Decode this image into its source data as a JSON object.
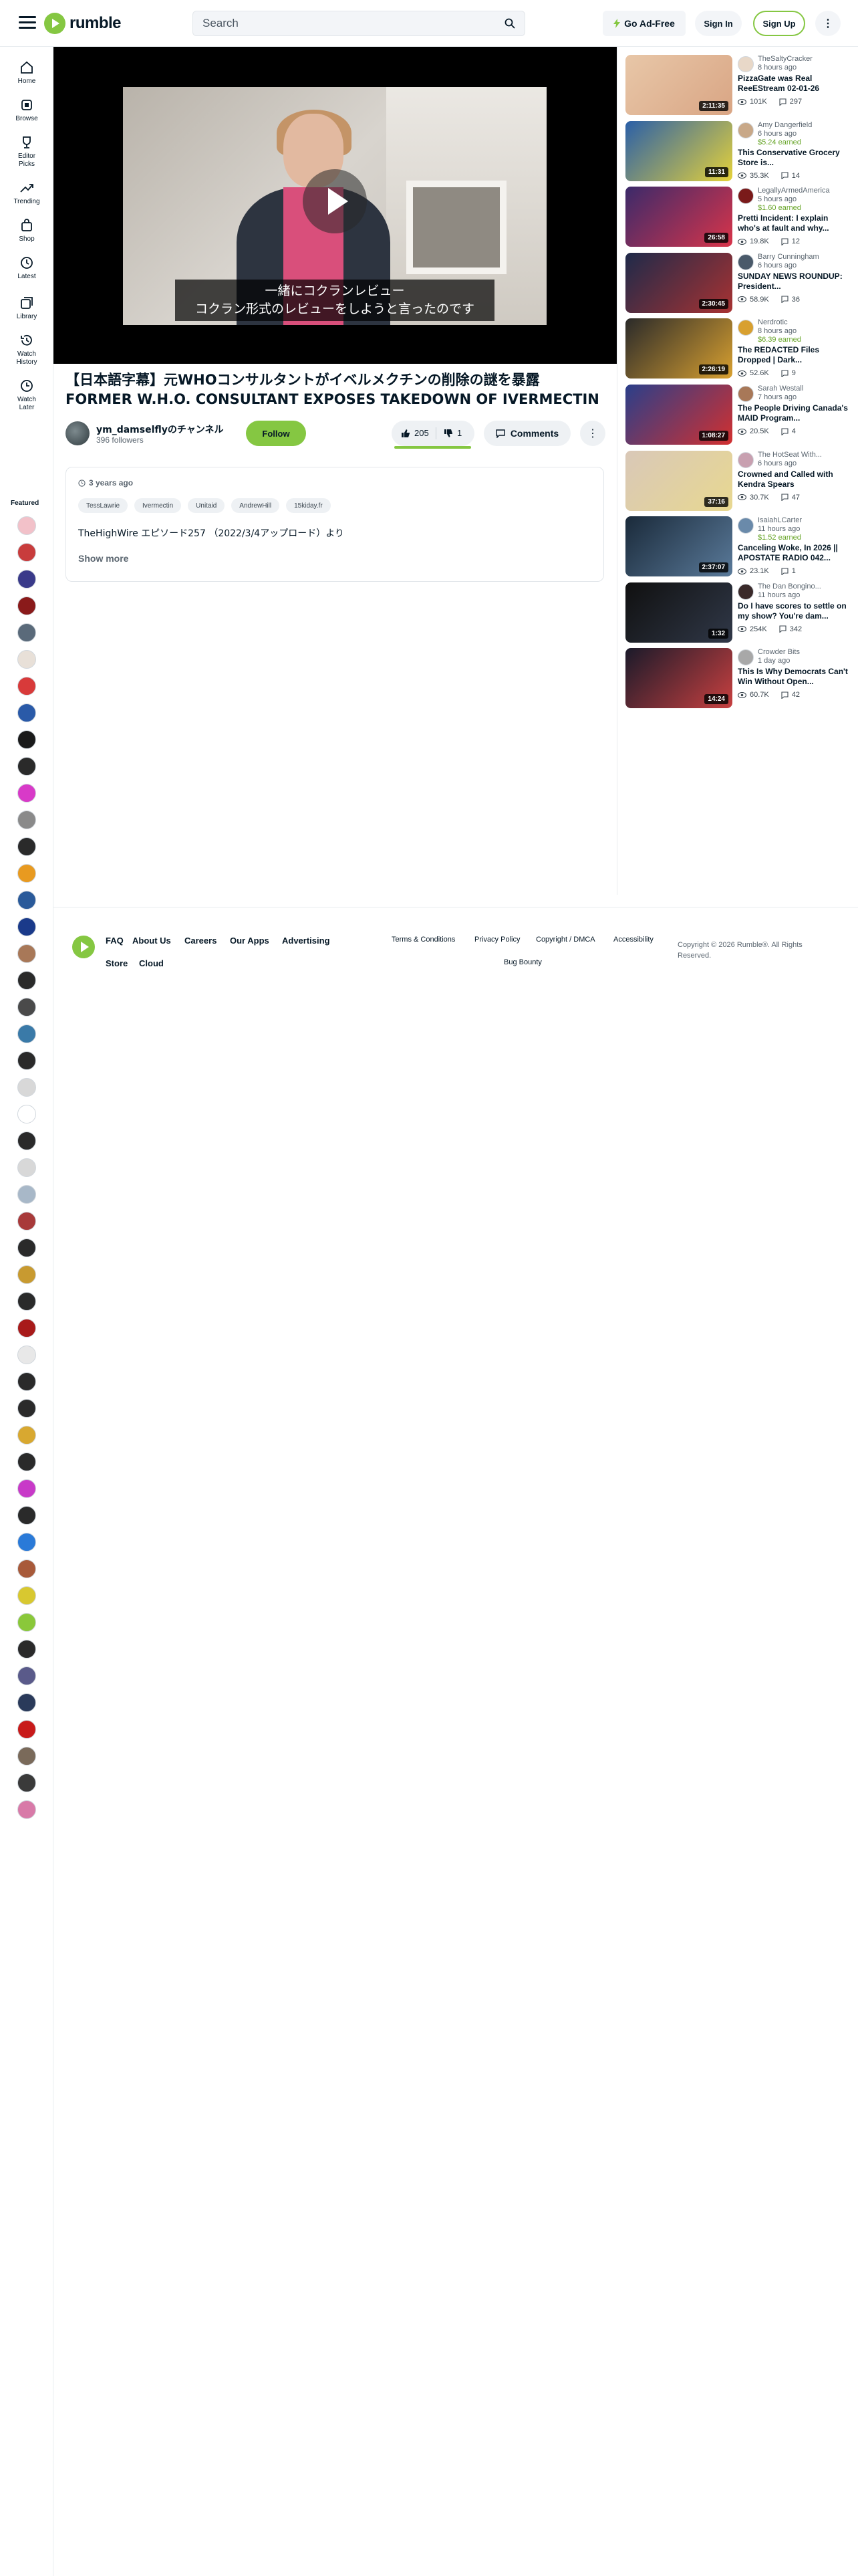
{
  "header": {
    "logo_text": "rumble",
    "search_placeholder": "Search",
    "go_adfree": "Go Ad-Free",
    "sign_in": "Sign In",
    "sign_up": "Sign Up",
    "brand_color": "#85c742"
  },
  "sidebar": {
    "items": [
      {
        "label": "Home",
        "icon": "home-icon"
      },
      {
        "label": "Browse",
        "icon": "browse-icon"
      },
      {
        "label": "Editor Picks",
        "icon": "trophy-icon"
      },
      {
        "label": "Trending",
        "icon": "trending-icon"
      },
      {
        "label": "Shop",
        "icon": "shop-icon"
      },
      {
        "label": "Latest",
        "icon": "clock-icon"
      },
      {
        "label": "Library",
        "icon": "library-icon"
      },
      {
        "label": "Watch History",
        "icon": "history-icon"
      },
      {
        "label": "Watch Later",
        "icon": "watch-later-icon"
      }
    ],
    "featured_label": "Featured"
  },
  "video": {
    "subtitle_line1": "一緒にコクランレビュー",
    "subtitle_line2": "コクラン形式のレビューをしようと言ったのです",
    "title": "【日本語字幕】元WHOコンサルタントがイベルメクチンの削除の謎を暴露 FORMER W.H.O. CONSULTANT EXPOSES TAKEDOWN OF IVERMECTIN",
    "channel_name": "ym_damselflyのチャンネル",
    "followers": "396 followers",
    "follow": "Follow",
    "likes": "205",
    "dislikes": "1",
    "like_fraction": 0.995,
    "comments": "Comments"
  },
  "description": {
    "time": "3 years ago",
    "tags": [
      "TessLawrie",
      "Ivermectin",
      "Unitaid",
      "AndrewHill",
      "15kiday.fr"
    ],
    "text": "TheHighWire エピソード257 （2022/3/4アップロード）より",
    "show_more": "Show more"
  },
  "recommendations": [
    {
      "author": "TheSaltyCracker",
      "ago": "8 hours ago",
      "earned": "",
      "title": "PizzaGate was Real ReeEStream 02-01-26",
      "views": "101K",
      "comments": "297",
      "duration": "2:11:35"
    },
    {
      "author": "Amy Dangerfield",
      "ago": "6 hours ago",
      "earned": "$5.24 earned",
      "title": "This Conservative Grocery Store is...",
      "views": "35.3K",
      "comments": "14",
      "duration": "11:31"
    },
    {
      "author": "LegallyArmedAmerica",
      "ago": "5 hours ago",
      "earned": "$1.60 earned",
      "title": "Pretti Incident: I explain who's at fault and why...",
      "views": "19.8K",
      "comments": "12",
      "duration": "26:58"
    },
    {
      "author": "Barry Cunningham",
      "ago": "6 hours ago",
      "earned": "",
      "title": "SUNDAY NEWS ROUNDUP: President...",
      "views": "58.9K",
      "comments": "36",
      "duration": "2:30:45"
    },
    {
      "author": "Nerdrotic",
      "ago": "8 hours ago",
      "earned": "$6.39 earned",
      "title": "The REDACTED Files Dropped | Dark...",
      "views": "52.6K",
      "comments": "9",
      "duration": "2:26:19"
    },
    {
      "author": "Sarah Westall",
      "ago": "7 hours ago",
      "earned": "",
      "title": "The People Driving Canada's MAID Program...",
      "views": "20.5K",
      "comments": "4",
      "duration": "1:08:27"
    },
    {
      "author": "The HotSeat With...",
      "ago": "6 hours ago",
      "earned": "",
      "title": "Crowned and Called with Kendra Spears",
      "views": "30.7K",
      "comments": "47",
      "duration": "37:16"
    },
    {
      "author": "IsaiahLCarter",
      "ago": "11 hours ago",
      "earned": "$1.52 earned",
      "title": "Canceling Woke, In 2026 || APOSTATE RADIO 042...",
      "views": "23.1K",
      "comments": "1",
      "duration": "2:37:07"
    },
    {
      "author": "The Dan Bongino...",
      "ago": "11 hours ago",
      "earned": "",
      "title": "Do I have scores to settle on my show? You're dam...",
      "views": "254K",
      "comments": "342",
      "duration": "1:32"
    },
    {
      "author": "Crowder Bits",
      "ago": "1 day ago",
      "earned": "",
      "title": "This Is Why Democrats Can't Win Without Open...",
      "views": "60.7K",
      "comments": "42",
      "duration": "14:24"
    }
  ],
  "footer": {
    "links": [
      "FAQ",
      "About Us",
      "Careers",
      "Our Apps",
      "Advertising",
      "Store",
      "Cloud"
    ],
    "small_links": [
      "Terms & Conditions",
      "Privacy Policy",
      "Copyright / DMCA",
      "Accessibility",
      "Bug Bounty"
    ],
    "copyright": "Copyright © 2026 Rumble®. All Rights Reserved."
  }
}
